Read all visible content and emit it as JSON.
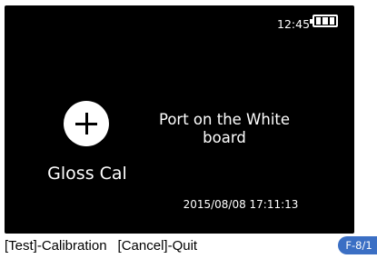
{
  "status": {
    "clock": "12:45",
    "battery_icon": "battery-full-icon",
    "battery_level": 1.0
  },
  "main": {
    "action_icon": "plus-circle-icon",
    "action_label": "Gloss Cal",
    "message": "Port on the White board",
    "datetime": "2015/08/08 17:11:13"
  },
  "footer": {
    "hint_test": "[Test]-Calibration",
    "hint_cancel": "[Cancel]-Quit",
    "page_code": "F-8/1"
  },
  "colors": {
    "screen_background": "#000000",
    "screen_text": "#ffffff",
    "badge": "#3b6fc4"
  }
}
